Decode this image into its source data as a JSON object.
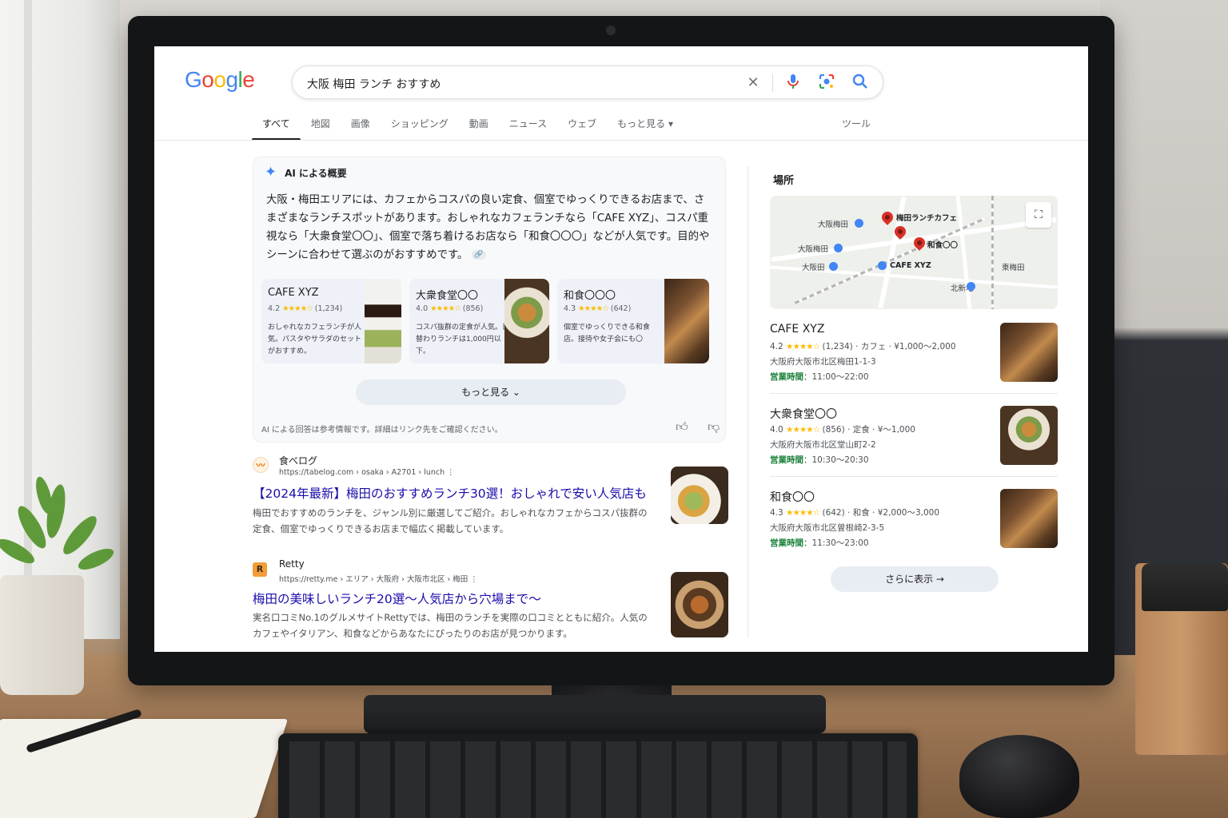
{
  "search": {
    "logo_letters": [
      {
        "ch": "G",
        "color": "#4285F4"
      },
      {
        "ch": "o",
        "color": "#EA4335"
      },
      {
        "ch": "o",
        "color": "#FBBC05"
      },
      {
        "ch": "g",
        "color": "#4285F4"
      },
      {
        "ch": "l",
        "color": "#34A853"
      },
      {
        "ch": "e",
        "color": "#EA4335"
      }
    ],
    "query": "大阪 梅田 ランチ おすすめ",
    "icons": [
      "close-icon",
      "mic-icon",
      "lens-icon",
      "search-icon"
    ]
  },
  "tabs": [
    {
      "label": "すべて",
      "active": true
    },
    {
      "label": "地図"
    },
    {
      "label": "画像"
    },
    {
      "label": "ショッピング"
    },
    {
      "label": "動画"
    },
    {
      "label": "ニュース"
    },
    {
      "label": "ウェブ"
    },
    {
      "label": "もっと見る ▾"
    }
  ],
  "tools_label": "ツール",
  "ai_overview": {
    "heading": "AI による概要",
    "text": "大阪・梅田エリアには、カフェからコスパの良い定食、個室でゆっくりできるお店まで、さまざまなランチスポットがあります。おしゃれなカフェランチなら「CAFE XYZ」、コスパ重視なら「大衆食堂〇〇」、個室で落ち着けるお店なら「和食〇〇〇」などが人気です。目的やシーンに合わせて選ぶのがおすすめです。",
    "cards": [
      {
        "name": "CAFE XYZ",
        "rating": "4.2",
        "stars": "★★★★☆",
        "count": "(1,234)",
        "desc": "おしゃれなカフェランチが人気。パスタやサラダのセットがおすすめ。"
      },
      {
        "name": "大衆食堂〇〇",
        "rating": "4.0",
        "stars": "★★★★☆",
        "count": "(856)",
        "desc": "コスパ抜群の定食が人気。日替わりランチは1,000円以下。"
      },
      {
        "name": "和食〇〇〇",
        "rating": "4.3",
        "stars": "★★★★☆",
        "count": "(642)",
        "desc": "個室でゆっくりできる和食店。接待や女子会にも〇"
      }
    ],
    "more_label": "もっと見る ⌄",
    "footer": "AI による回答は参考情報です。詳細はリンク先をご確認ください。"
  },
  "results": [
    {
      "site": "食べログ",
      "url": "https://tabelog.com › osaka › A2701 › lunch  ⋮",
      "title": "【2024年最新】梅田のおすすめランチ30選！おしゃれで安い人気店も",
      "snippet": "梅田でおすすめのランチを、ジャンル別に厳選してご紹介。おしゃれなカフェからコスパ抜群の定食、個室でゆっくりできるお店まで幅広く掲載しています。"
    },
    {
      "site": "Retty",
      "url": "https://retty.me › エリア › 大阪府 › 大阪市北区 › 梅田  ⋮",
      "title": "梅田の美味しいランチ20選〜人気店から穴場まで〜",
      "snippet": "実名口コミNo.1のグルメサイトRettyでは、梅田のランチを実際の口コミとともに紹介。人気のカフェやイタリアン、和食などからあなたにぴったりのお店が見つかります。"
    }
  ],
  "places": {
    "title": "場所",
    "map_labels": {
      "umeda_station": "大阪梅田",
      "umeda_station2": "大阪梅田",
      "osaka_station": "大阪田",
      "higashi_umeda": "東梅田",
      "kitashinchi": "北新地",
      "pin_cafe_lunch": "梅田ランチカフェ",
      "pin_washoku": "和食〇〇",
      "pin_cafe_xyz": "CAFE XYZ"
    },
    "items": [
      {
        "name": "CAFE XYZ",
        "rating": "4.2",
        "stars": "★★★★☆",
        "meta": "(1,234) · カフェ · ¥1,000〜2,000",
        "address": "大阪府大阪市北区梅田1-1-3",
        "hours_label": "営業時間",
        "hours": "：11:00〜22:00"
      },
      {
        "name": "大衆食堂〇〇",
        "rating": "4.0",
        "stars": "★★★★☆",
        "meta": "(856) · 定食 · ¥〜1,000",
        "address": "大阪府大阪市北区堂山町2-2",
        "hours_label": "営業時間",
        "hours": "：10:30〜20:30"
      },
      {
        "name": "和食〇〇",
        "rating": "4.3",
        "stars": "★★★★☆",
        "meta": "(642) · 和食 · ¥2,000〜3,000",
        "address": "大阪府大阪市北区曽根崎2-3-5",
        "hours_label": "営業時間",
        "hours": "：11:30〜23:00"
      }
    ],
    "show_more_label": "さらに表示  →"
  },
  "colors": {
    "link": "#1a0dab",
    "open_green": "#188038",
    "star": "#fbbc04",
    "accent_blue": "#4285f4",
    "pin_red": "#d93025"
  }
}
